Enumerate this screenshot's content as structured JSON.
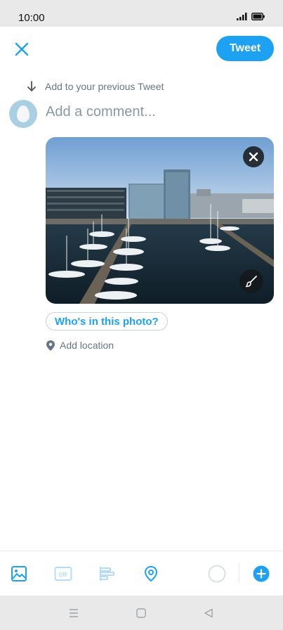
{
  "status_bar": {
    "time": "10:00"
  },
  "compose": {
    "tweet_label": "Tweet",
    "reply_hint": "Add to your previous Tweet",
    "comment_placeholder": "Add a comment...",
    "tag_people_label": "Who's in this photo?",
    "add_location_label": "Add location"
  },
  "colors": {
    "accent": "#1da1f2",
    "secondary_text": "#657786"
  },
  "toolbar": {
    "items": [
      "image-icon",
      "gif-icon",
      "poll-icon",
      "location-icon",
      "character-count-ring",
      "add-thread-icon"
    ],
    "gif_label": "GIF"
  },
  "nav_bar": {
    "items": [
      "menu-icon",
      "home-icon",
      "back-icon"
    ]
  }
}
